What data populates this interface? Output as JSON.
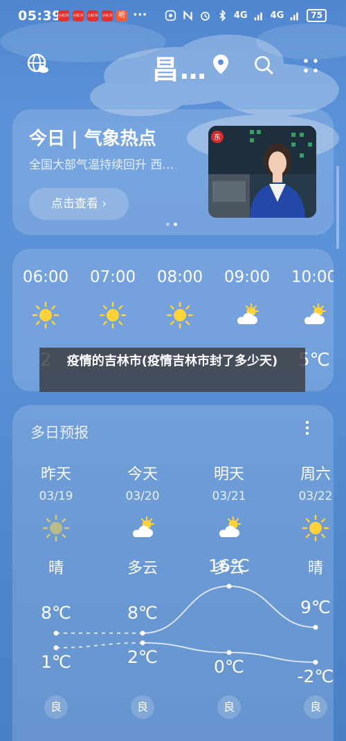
{
  "status_bar": {
    "time": "05:39",
    "apps": [
      "小红书",
      "小红书",
      "小红书",
      "小红书",
      "听"
    ],
    "more": "···",
    "network": "4G",
    "network2": "4G",
    "battery": "75"
  },
  "header": {
    "city": "昌…"
  },
  "news": {
    "title": "今日 | 气象热点",
    "subtitle": "全国大部气温持续回升 西…",
    "button": "点击查看 ›"
  },
  "hourly": {
    "items": [
      {
        "time": "06:00",
        "icon": "sun-icon",
        "temp": "2"
      },
      {
        "time": "07:00",
        "icon": "sun-icon",
        "temp": ""
      },
      {
        "time": "08:00",
        "icon": "sun-icon",
        "temp": ""
      },
      {
        "time": "09:00",
        "icon": "partly-cloudy-icon",
        "temp": ""
      },
      {
        "time": "10:00",
        "icon": "partly-cloudy-icon",
        "temp": "5℃"
      }
    ]
  },
  "overlay": {
    "text": "疫情的吉林市(疫情吉林市封了多少天)"
  },
  "daily": {
    "title": "多日预报",
    "days": [
      {
        "name": "昨天",
        "date": "03/19",
        "icon": "sun-icon",
        "cond": "晴",
        "high": "8℃",
        "low": "1℃",
        "aqi": "良",
        "high_val": 8,
        "low_val": 1
      },
      {
        "name": "今天",
        "date": "03/20",
        "icon": "partly-cloudy-icon",
        "cond": "多云",
        "high": "8℃",
        "low": "2℃",
        "aqi": "良",
        "high_val": 8,
        "low_val": 2
      },
      {
        "name": "明天",
        "date": "03/21",
        "icon": "partly-cloudy-icon",
        "cond": "多云",
        "high": "16℃",
        "low": "0℃",
        "aqi": "良",
        "high_val": 16,
        "low_val": 0
      },
      {
        "name": "周六",
        "date": "03/22",
        "icon": "sun-icon",
        "cond": "晴",
        "high": "9℃",
        "low": "-2℃",
        "aqi": "良",
        "high_val": 9,
        "low_val": -2
      }
    ]
  },
  "colors": {
    "sun": "#ffd23a",
    "cloud": "#ffffff",
    "bg_top": "#4f86cf"
  }
}
